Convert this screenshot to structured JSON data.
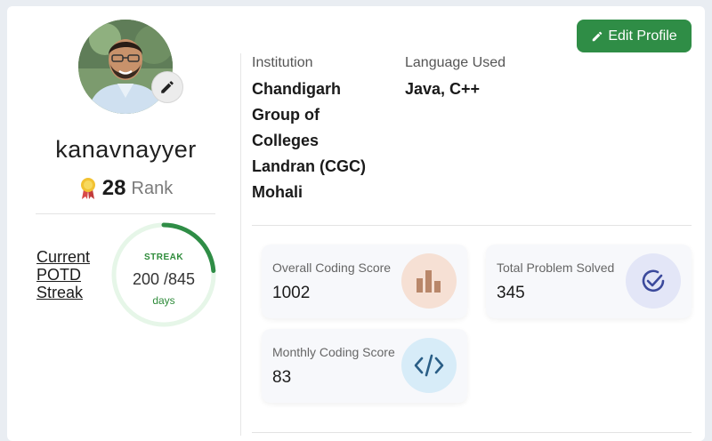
{
  "profile": {
    "username": "kanavnayyer",
    "rank_number": "28",
    "rank_label": "Rank"
  },
  "streak": {
    "label_lines": [
      "Current",
      "POTD",
      "Streak"
    ],
    "title": "STREAK",
    "value": "200 /845",
    "unit": "days",
    "current": 200,
    "best": 845
  },
  "actions": {
    "edit_profile_label": "Edit Profile"
  },
  "info": {
    "institution_label": "Institution",
    "institution_lines": [
      "Chandigarh",
      "Group of",
      "Colleges",
      "Landran (CGC)",
      "Mohali"
    ],
    "language_label": "Language Used",
    "language_value": "Java, C++"
  },
  "stats": {
    "overall": {
      "label": "Overall Coding Score",
      "value": "1002",
      "icon": "bar-chart-icon"
    },
    "solved": {
      "label": "Total Problem Solved",
      "value": "345",
      "icon": "check-circle-icon"
    },
    "monthly": {
      "label": "Monthly Coding Score",
      "value": "83",
      "icon": "code-icon"
    }
  },
  "colors": {
    "accent_green": "#2f8d46",
    "ring_track": "#e6f6e8",
    "ring_progress": "#2f8d46"
  }
}
